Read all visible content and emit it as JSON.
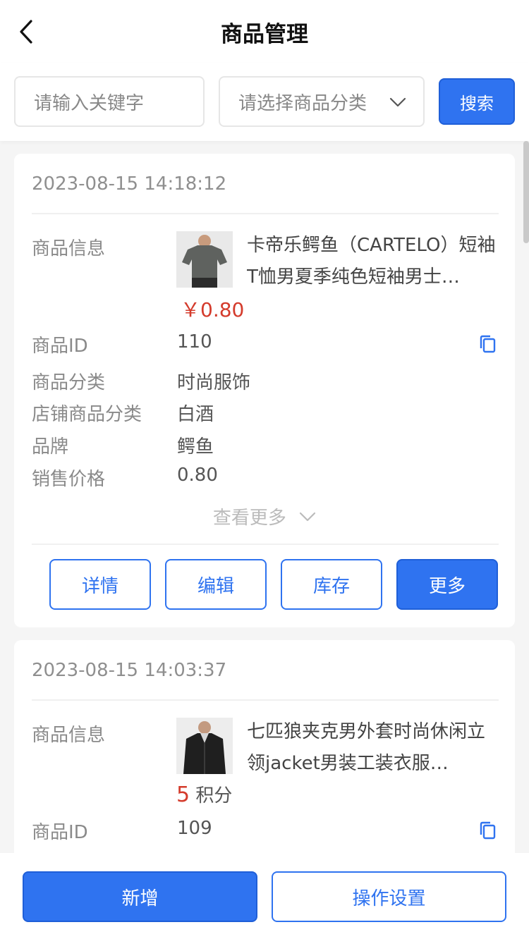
{
  "header": {
    "title": "商品管理",
    "back_icon": "chevron-left-icon"
  },
  "search": {
    "keyword_placeholder": "请输入关键字",
    "category_placeholder": "请选择商品分类",
    "search_label": "搜索"
  },
  "labels": {
    "product_info": "商品信息",
    "product_id": "商品ID",
    "category": "商品分类",
    "store_category": "店铺商品分类",
    "brand": "品牌",
    "sale_price": "销售价格",
    "see_more": "查看更多"
  },
  "products": [
    {
      "time": "2023-08-15 14:18:12",
      "name": "卡帝乐鳄鱼（CARTELO）短袖T恤男夏季纯色短袖男士…",
      "price": "￥0.80",
      "id": "110",
      "category": "时尚服饰",
      "store_category": "白酒",
      "brand": "鳄鱼",
      "sale_price": "0.80",
      "actions": [
        "详情",
        "编辑",
        "库存",
        "更多"
      ]
    },
    {
      "time": "2023-08-15 14:03:37",
      "name": "七匹狼夹克男外套时尚休闲立领jacket男装工装衣服…",
      "points_value": "5",
      "points_unit": "积分",
      "id": "109"
    }
  ],
  "footer": {
    "add_label": "新增",
    "settings_label": "操作设置"
  },
  "colors": {
    "primary": "#2f73f0",
    "price": "#d43b2c"
  }
}
